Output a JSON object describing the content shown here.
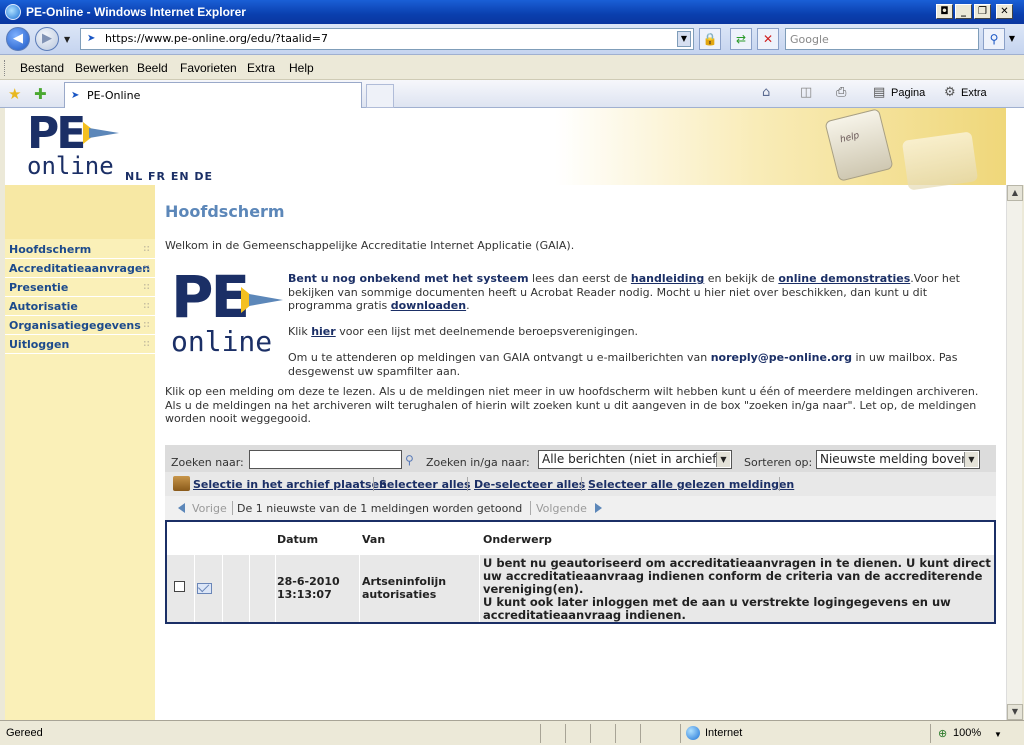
{
  "window": {
    "title": "PE-Online - Windows Internet Explorer"
  },
  "addressbar": {
    "url": "https://www.pe-online.org/edu/?taalid=7",
    "search_placeholder": "Google"
  },
  "menu": [
    "Bestand",
    "Bewerken",
    "Beeld",
    "Favorieten",
    "Extra",
    "Help"
  ],
  "tab": {
    "label": "PE-Online"
  },
  "commandbar": {
    "page_label": "Pagina",
    "tools_label": "Extra"
  },
  "header": {
    "logo_pe": "PE",
    "logo_online": "online",
    "languages": "NL FR EN DE",
    "help_key": "help"
  },
  "sidebar": {
    "items": [
      {
        "label": "Hoofdscherm"
      },
      {
        "label": "Accreditatieaanvragen"
      },
      {
        "label": "Presentie"
      },
      {
        "label": "Autorisatie"
      },
      {
        "label": "Organisatiegegevens"
      },
      {
        "label": "Uitloggen"
      }
    ]
  },
  "main": {
    "title": "Hoofdscherm",
    "welcome": "Welkom in de Gemeenschappelijke Accreditatie Internet Applicatie (GAIA).",
    "info1": {
      "bold_start": "Bent u nog onbekend met het systeem",
      "text1": " lees dan eerst de ",
      "link_handleiding": "handleiding",
      "text2": " en bekijk de ",
      "link_demo": "online demonstraties",
      "text3": ".Voor het bekijken van sommige documenten heeft u Acrobat Reader nodig. Mocht u hier niet over beschikken, dan kunt u dit programma gratis ",
      "link_download": "downloaden",
      "text4": "."
    },
    "info2": {
      "text1": "Klik ",
      "link_hier": "hier",
      "text2": " voor een lijst met deelnemende beroepsverenigingen."
    },
    "info3": {
      "text1": "Om u te attenderen op meldingen van GAIA ontvangt u e-mailberichten van ",
      "email": "noreply@pe-online.org",
      "text2": " in uw mailbox. Pas desgewenst uw spamfilter aan."
    },
    "instructions": "Klik op een melding om deze te lezen. Als u de meldingen niet meer in uw hoofdscherm wilt hebben kunt u één of meerdere meldingen archiveren. Als u de meldingen na het archiveren wilt terughalen of hierin wilt zoeken kunt u dit aangeven in de box \"zoeken in/ga naar\". Let op, de meldingen worden nooit weggegooid."
  },
  "search": {
    "search_label": "Zoeken naar:",
    "search_value": "",
    "scope_label": "Zoeken in/ga naar:",
    "scope_value": "Alle berichten (niet in archief)",
    "sort_label": "Sorteren op:",
    "sort_value": "Nieuwste melding boven"
  },
  "actions": {
    "archive": "Selectie in het archief plaatsen",
    "select_all": "Selecteer alles",
    "deselect_all": "De-selecteer alles",
    "select_read": "Selecteer alle gelezen meldingen"
  },
  "pager": {
    "prev": "Vorige",
    "summary": "De 1 nieuwste van de 1 meldingen worden getoond",
    "next": "Volgende"
  },
  "table": {
    "headers": {
      "date": "Datum",
      "from": "Van",
      "subject": "Onderwerp"
    },
    "rows": [
      {
        "date": "28-6-2010",
        "time": "13:13:07",
        "from_line1": "Artseninfolijn",
        "from_line2": "autorisaties",
        "subject_line1": "U bent nu geautoriseerd om accreditatieaanvragen in te dienen. U kunt direct",
        "subject_line2": "uw accreditatieaanvraag indienen conform de criteria van de accrediterende",
        "subject_line3": "vereniging(en).",
        "subject_line4": "U kunt ook later inloggen met de aan u verstrekte logingegevens en uw",
        "subject_line5": "accreditatieaanvraag indienen."
      }
    ]
  },
  "statusbar": {
    "status": "Gereed",
    "zone": "Internet",
    "zoom": "100%"
  },
  "colors": {
    "brand_blue": "#1b2f66",
    "sidebar_yellow": "#faf0b8",
    "title_blue": "#5c87b9"
  }
}
